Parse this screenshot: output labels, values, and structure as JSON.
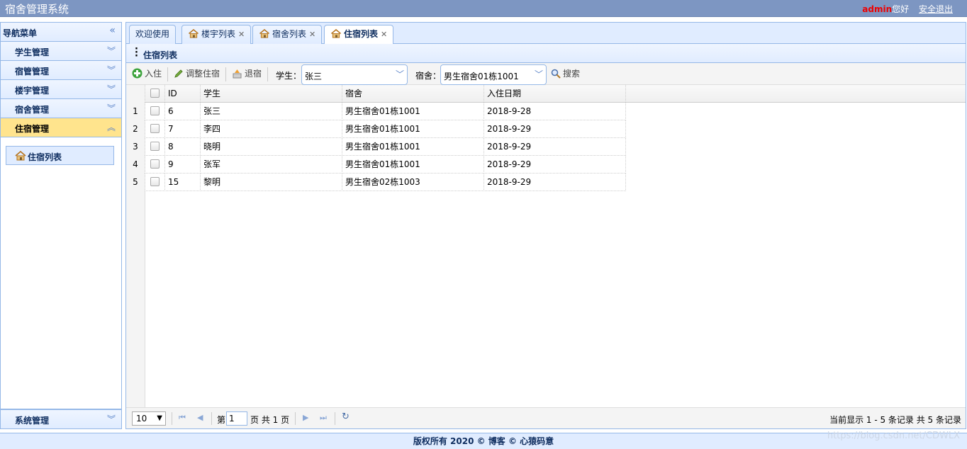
{
  "header": {
    "app_title": "宿舍管理系统",
    "user_name": "admin",
    "greeting": "您好",
    "logout_label": "安全退出"
  },
  "sidebar": {
    "title": "导航菜单",
    "collapse_icon": "double-chevron-left-icon",
    "items": [
      {
        "label": "学生管理",
        "expanded": false
      },
      {
        "label": "宿管管理",
        "expanded": false
      },
      {
        "label": "楼宇管理",
        "expanded": false
      },
      {
        "label": "宿舍管理",
        "expanded": false
      },
      {
        "label": "住宿管理",
        "expanded": true
      }
    ],
    "active_sub": {
      "label": "住宿列表",
      "icon": "home-icon"
    },
    "bottom_item": {
      "label": "系统管理",
      "expanded": false
    }
  },
  "tabs": [
    {
      "label": "欢迎使用",
      "closable": false,
      "icon": ""
    },
    {
      "label": "楼宇列表",
      "closable": true,
      "icon": "home-icon"
    },
    {
      "label": "宿舍列表",
      "closable": true,
      "icon": "home-icon"
    },
    {
      "label": "住宿列表",
      "closable": true,
      "icon": "home-icon",
      "selected": true
    }
  ],
  "panel": {
    "title": "住宿列表"
  },
  "toolbar": {
    "checkin_label": "入住",
    "adjust_label": "调整住宿",
    "checkout_label": "退宿",
    "student_label": "学生：",
    "student_value": "张三",
    "dorm_label": "宿舍：",
    "dorm_value": "男生宿舍01栋1001",
    "search_label": "搜索"
  },
  "table": {
    "columns": [
      "ID",
      "学生",
      "宿舍",
      "入住日期"
    ],
    "rows": [
      {
        "num": "1",
        "id": "6",
        "student": "张三",
        "dorm": "男生宿舍01栋1001",
        "date": "2018-9-28"
      },
      {
        "num": "2",
        "id": "7",
        "student": "李四",
        "dorm": "男生宿舍01栋1001",
        "date": "2018-9-29"
      },
      {
        "num": "3",
        "id": "8",
        "student": "晓明",
        "dorm": "男生宿舍01栋1001",
        "date": "2018-9-29"
      },
      {
        "num": "4",
        "id": "9",
        "student": "张军",
        "dorm": "男生宿舍01栋1001",
        "date": "2018-9-29"
      },
      {
        "num": "5",
        "id": "15",
        "student": "黎明",
        "dorm": "男生宿舍02栋1003",
        "date": "2018-9-29"
      }
    ]
  },
  "pager": {
    "page_size": "10",
    "page_prefix": "第",
    "current_page": "1",
    "page_suffix": "页 共 1 页",
    "info": "当前显示 1 - 5 条记录 共 5 条记录"
  },
  "footer": {
    "text": "版权所有 2020 © 博客 © 心猿码意"
  },
  "watermark": "https://blog.csdn.net/CDWLX",
  "colors": {
    "header_bg": "#7d96c2",
    "accent_border": "#95b8e7",
    "active_menu": "#ffe48d",
    "user_name": "#ee0000"
  }
}
